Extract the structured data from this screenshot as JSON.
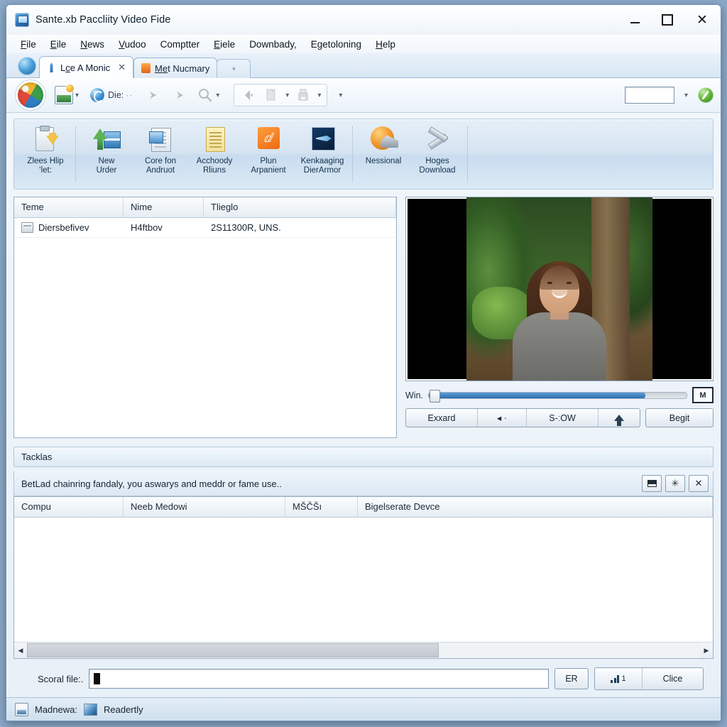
{
  "window": {
    "title": "Sante.xb Paccliity Video Fide",
    "app_icon": "app-window-icon",
    "controls": {
      "minimize": "–",
      "maximize": "□",
      "close": "✕"
    }
  },
  "menubar": [
    {
      "pre": "",
      "mn": "F",
      "post": "ile"
    },
    {
      "pre": "",
      "mn": "E",
      "post": "ile"
    },
    {
      "pre": "",
      "mn": "N",
      "post": "ews"
    },
    {
      "pre": "",
      "mn": "V",
      "post": "udoo"
    },
    {
      "pre": "Compt",
      "mn": "",
      "post": "ter"
    },
    {
      "pre": "",
      "mn": "E",
      "post": "iele"
    },
    {
      "pre": "Downbad",
      "mn": "",
      "post": "y,"
    },
    {
      "pre": "E",
      "mn": "g",
      "post": "etoloning"
    },
    {
      "pre": "",
      "mn": "H",
      "post": "elp"
    }
  ],
  "tabs": {
    "globe_icon": "globe-icon",
    "items": [
      {
        "icon": "person-pin-icon",
        "label_pre": "L",
        "label_mn": "c",
        "label_post": "e A Monic",
        "label": "Lce A Monic",
        "closable": true,
        "active": true
      },
      {
        "icon": "folder-orange-icon",
        "label_pre": "M",
        "label_mn": "e",
        "label_post": "t Nucmary",
        "label": "Met Nucmary",
        "closable": false,
        "active": false
      }
    ],
    "overflow_chevron": "▾"
  },
  "quick_access": {
    "orb": "app-orb-button",
    "photo_button": {
      "icon": "photo-add-icon",
      "dropdown": "▾"
    },
    "sync_button": {
      "icon": "refresh-circle-icon",
      "label": "Die:",
      "dots": "··"
    },
    "arrow_in": "arrow-merge-right-icon",
    "arrow_out": "arrow-merge-down-icon",
    "zoom": {
      "icon": "magnifier-icon",
      "dropdown": "▾"
    },
    "group": {
      "back_icon": "back-arrow-icon",
      "copy": {
        "icon": "copy-page-icon",
        "dropdown": "▾"
      },
      "archive": {
        "icon": "archive-box-icon",
        "dropdown": "▾"
      }
    },
    "overflow": "▾",
    "search_value": "",
    "search_dropdown": "▾",
    "help_icon": "help-green-icon"
  },
  "ribbon": {
    "buttons": [
      {
        "icon": "clipboard-download-icon",
        "line1": "Zlees Hlip",
        "line2": "‘let:"
      },
      {
        "icon": "new-upload-icon",
        "line1": "New",
        "line2": "Urder"
      },
      {
        "icon": "screen-document-icon",
        "line1": "Core fon",
        "line2": "Andruot"
      },
      {
        "icon": "notes-page-icon",
        "line1": "Acchoody",
        "line2": "Rliuns"
      },
      {
        "icon": "orange-swirl-icon",
        "line1": "Plun",
        "line2": "Arpanient"
      },
      {
        "icon": "navy-comet-icon",
        "line1": "Kenkaaging",
        "line2": "DierArmor"
      },
      {
        "icon": "gold-badge-icon",
        "line1": "Nessional",
        "line2": ""
      },
      {
        "icon": "wrench-tools-icon",
        "line1": "Hoges",
        "line2": "Download"
      }
    ]
  },
  "list_pane": {
    "headers": [
      "Teme",
      "Nime",
      "Tlieglo"
    ],
    "rows": [
      {
        "icon": "item-icon",
        "cells": [
          "Diersbefivev",
          "H4ftbov",
          "2S11300R, UNS."
        ]
      }
    ]
  },
  "video": {
    "preview_alt": "video-preview-woman-outdoors",
    "seek_label": "Win.",
    "seek_percent": 84,
    "monitor_button": "M",
    "buttons": {
      "expand": "Exxard",
      "back": "◂ ·",
      "time": "S-ːOW",
      "upload_icon": "upload-arrow-icon",
      "begin": "Begit"
    }
  },
  "section": {
    "header": "Tacklas",
    "message": "BetLad chainring fandaly, you aswarys and meddr or fame use..",
    "actions": [
      {
        "icon": "minimize-panel-icon",
        "glyph": "▃"
      },
      {
        "icon": "snowflake-icon",
        "glyph": "✳"
      },
      {
        "icon": "close-panel-icon",
        "glyph": "✕"
      }
    ]
  },
  "bottom_table": {
    "headers": [
      "Compu",
      "Neeb Medowi",
      "MŠČŠı",
      "Bigelserate Devce"
    ],
    "rows": []
  },
  "scrollbar": {
    "left_arrow": "◀",
    "right_arrow": "▶",
    "thumb_percent": 61
  },
  "file_row": {
    "label": "Scoral file:.",
    "value": "",
    "er_button": "ER",
    "dual": {
      "icon": "bars-chart-icon",
      "count": "1",
      "label": "Clice"
    }
  },
  "statusbar": {
    "icon1": "image-status-icon",
    "text1": "Madnewa:",
    "icon2": "network-status-icon",
    "text2": "Readertly"
  }
}
